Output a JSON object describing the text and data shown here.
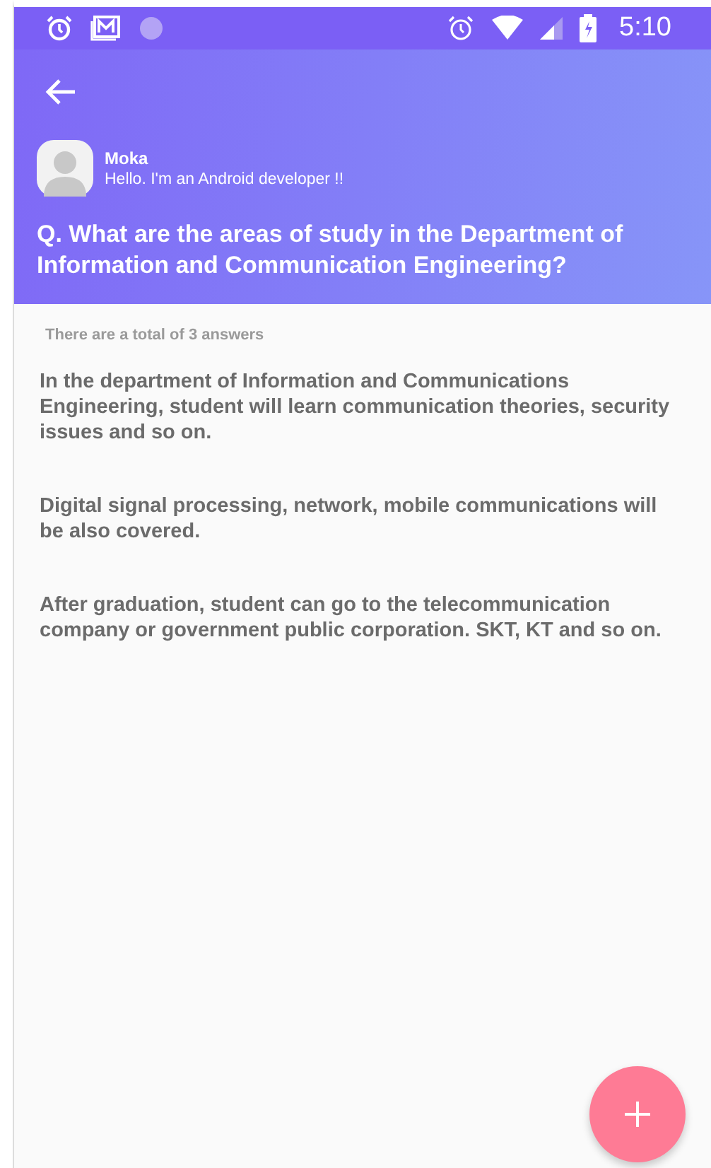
{
  "status_bar": {
    "time": "5:10"
  },
  "header": {
    "user": {
      "name": "Moka",
      "status": "Hello. I'm an Android developer !!"
    },
    "question": "Q. What are the areas of study in the Department of Information and Communication Engineering?"
  },
  "answers_count": "There are a total of 3 answers",
  "answers": [
    "In the department of Information and Communications Engineering, student will learn communication theories, security issues and so on.",
    "Digital signal processing, network, mobile communications will be also covered.",
    "After graduation, student can go to the telecommunication company or government public corporation. SKT, KT and so on."
  ]
}
